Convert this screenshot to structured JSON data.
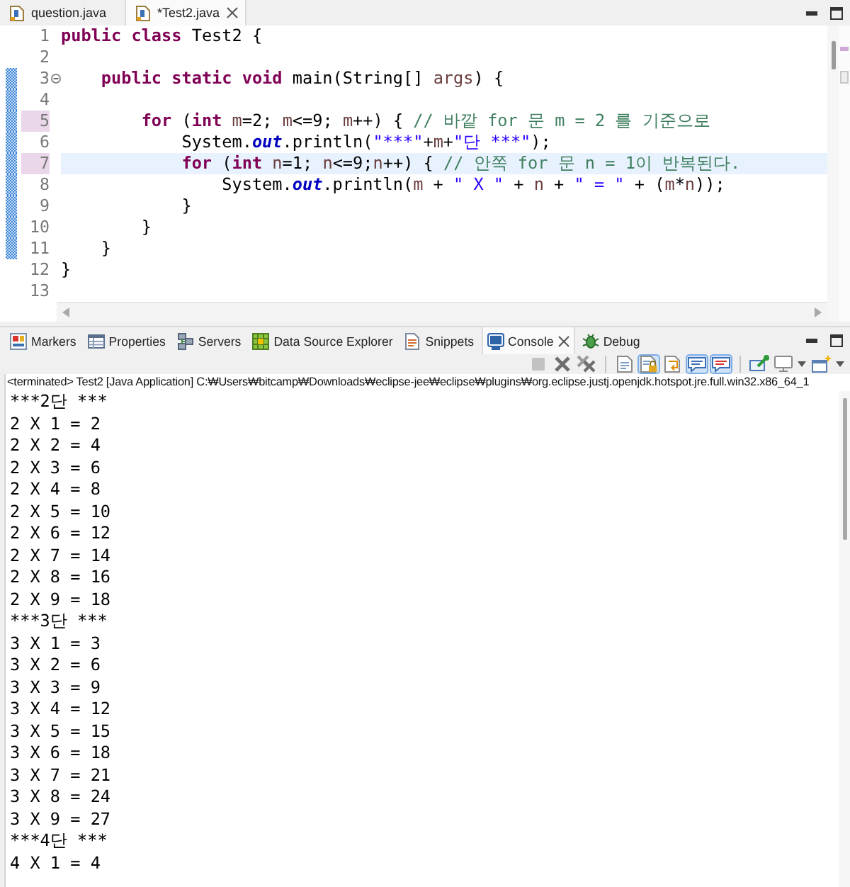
{
  "editor_tabs": [
    {
      "label": "question.java",
      "selected": false
    },
    {
      "label": "*Test2.java",
      "selected": true
    }
  ],
  "editor": {
    "lines": [
      {
        "number": "1",
        "changed": false,
        "marked": false,
        "current": false,
        "fold_marker": false,
        "tokens": [
          {
            "kind": "keyword",
            "text": "public"
          },
          {
            "kind": "keyword",
            "text": " class"
          },
          {
            "kind": "plain",
            "text": " Test2 {"
          }
        ]
      },
      {
        "number": "2",
        "changed": false,
        "marked": false,
        "current": false,
        "fold_marker": false
      },
      {
        "number": "3",
        "changed": true,
        "marked": false,
        "current": false,
        "fold_marker": true,
        "tokens": [
          {
            "kind": "keyword",
            "text": "    public"
          },
          {
            "kind": "keyword",
            "text": " static"
          },
          {
            "kind": "keyword",
            "text": " void"
          },
          {
            "kind": "plain",
            "text": " main(String[] "
          },
          {
            "kind": "variable",
            "text": "args"
          },
          {
            "kind": "plain",
            "text": ") {"
          }
        ]
      },
      {
        "number": "4",
        "changed": true,
        "marked": false,
        "current": false,
        "fold_marker": false
      },
      {
        "number": "5",
        "changed": true,
        "marked": true,
        "current": false,
        "fold_marker": false,
        "tokens": [
          {
            "kind": "keyword",
            "text": "        for"
          },
          {
            "kind": "plain",
            "text": " ("
          },
          {
            "kind": "keyword",
            "text": "int"
          },
          {
            "kind": "variable",
            "text": " m"
          },
          {
            "kind": "plain",
            "text": "=2; "
          },
          {
            "kind": "variable",
            "text": "m"
          },
          {
            "kind": "plain",
            "text": "<=9; "
          },
          {
            "kind": "variable",
            "text": "m"
          },
          {
            "kind": "plain",
            "text": "++) { "
          },
          {
            "kind": "comment",
            "text": "// 바깥 for 문 m = 2 를 기준으로"
          }
        ]
      },
      {
        "number": "6",
        "changed": true,
        "marked": false,
        "current": false,
        "fold_marker": false,
        "tokens": [
          {
            "kind": "plain",
            "text": "            System."
          },
          {
            "kind": "field",
            "text": "out"
          },
          {
            "kind": "plain",
            "text": ".println("
          },
          {
            "kind": "string",
            "text": "\"***\""
          },
          {
            "kind": "plain",
            "text": "+"
          },
          {
            "kind": "variable",
            "text": "m"
          },
          {
            "kind": "plain",
            "text": "+"
          },
          {
            "kind": "string",
            "text": "\"단 ***\""
          },
          {
            "kind": "plain",
            "text": ");"
          }
        ]
      },
      {
        "number": "7",
        "changed": true,
        "marked": true,
        "current": true,
        "fold_marker": false,
        "tokens": [
          {
            "kind": "keyword",
            "text": "            for"
          },
          {
            "kind": "plain",
            "text": " ("
          },
          {
            "kind": "keyword",
            "text": "int"
          },
          {
            "kind": "variable",
            "text": " n"
          },
          {
            "kind": "plain",
            "text": "=1; "
          },
          {
            "kind": "variable",
            "text": "n"
          },
          {
            "kind": "plain",
            "text": "<=9;"
          },
          {
            "kind": "variable",
            "text": "n"
          },
          {
            "kind": "plain",
            "text": "++) { "
          },
          {
            "kind": "comment",
            "text": "// 안쪽 for 문 n = 1이 반복된다."
          }
        ]
      },
      {
        "number": "8",
        "changed": true,
        "marked": false,
        "current": false,
        "fold_marker": false,
        "tokens": [
          {
            "kind": "plain",
            "text": "                System."
          },
          {
            "kind": "field",
            "text": "out"
          },
          {
            "kind": "plain",
            "text": ".println("
          },
          {
            "kind": "variable",
            "text": "m"
          },
          {
            "kind": "plain",
            "text": " + "
          },
          {
            "kind": "string",
            "text": "\" X \""
          },
          {
            "kind": "plain",
            "text": " + "
          },
          {
            "kind": "variable",
            "text": "n"
          },
          {
            "kind": "plain",
            "text": " + "
          },
          {
            "kind": "string",
            "text": "\" = \""
          },
          {
            "kind": "plain",
            "text": " + ("
          },
          {
            "kind": "variable",
            "text": "m"
          },
          {
            "kind": "plain",
            "text": "*"
          },
          {
            "kind": "variable",
            "text": "n"
          },
          {
            "kind": "plain",
            "text": "));"
          }
        ]
      },
      {
        "number": "9",
        "changed": true,
        "marked": false,
        "current": false,
        "fold_marker": false,
        "tokens": [
          {
            "kind": "plain",
            "text": "            }"
          }
        ]
      },
      {
        "number": "10",
        "changed": true,
        "marked": false,
        "current": false,
        "fold_marker": false,
        "tokens": [
          {
            "kind": "plain",
            "text": "        }"
          }
        ]
      },
      {
        "number": "11",
        "changed": true,
        "marked": false,
        "current": false,
        "fold_marker": false,
        "tokens": [
          {
            "kind": "plain",
            "text": "    }"
          }
        ]
      },
      {
        "number": "12",
        "changed": false,
        "marked": false,
        "current": false,
        "fold_marker": false,
        "tokens": [
          {
            "kind": "plain",
            "text": "}"
          }
        ]
      },
      {
        "number": "13",
        "changed": false,
        "marked": false,
        "current": false,
        "fold_marker": false
      }
    ]
  },
  "view_tabs": [
    {
      "label": "Markers",
      "kind": "markers",
      "selected": false
    },
    {
      "label": "Properties",
      "kind": "properties",
      "selected": false
    },
    {
      "label": "Servers",
      "kind": "servers",
      "selected": false
    },
    {
      "label": "Data Source Explorer",
      "kind": "data-source",
      "selected": false
    },
    {
      "label": "Snippets",
      "kind": "snippets",
      "selected": false
    },
    {
      "label": "Console",
      "kind": "console",
      "selected": true
    },
    {
      "label": "Debug",
      "kind": "debug",
      "selected": false
    }
  ],
  "console_toolbar": [
    [
      {
        "kind": "stop",
        "on": false,
        "disabled": true,
        "menu": false
      },
      {
        "kind": "remove",
        "on": false,
        "disabled": false,
        "menu": false
      },
      {
        "kind": "remove-all",
        "on": false,
        "disabled": false,
        "menu": false
      }
    ],
    [
      {
        "kind": "clear",
        "on": false,
        "disabled": false,
        "menu": false
      },
      {
        "kind": "scroll-lock",
        "on": true,
        "disabled": false,
        "menu": false
      },
      {
        "kind": "word-wrap",
        "on": false,
        "disabled": false,
        "menu": false
      },
      {
        "kind": "stdout",
        "on": true,
        "disabled": false,
        "menu": false
      },
      {
        "kind": "stderr",
        "on": true,
        "disabled": false,
        "menu": false
      }
    ],
    [
      {
        "kind": "pin",
        "on": false,
        "disabled": false,
        "menu": false
      },
      {
        "kind": "display",
        "on": false,
        "disabled": false,
        "menu": true
      },
      {
        "kind": "open",
        "on": false,
        "disabled": false,
        "menu": true
      }
    ]
  ],
  "console": {
    "header": "<terminated> Test2 [Java Application] C:₩Users₩bitcamp₩Downloads₩eclipse-jee₩eclipse₩plugins₩org.eclipse.justj.openjdk.hotspot.jre.full.win32.x86_64_1",
    "lines": [
      "***2단 ***",
      "2 X 1 = 2",
      "2 X 2 = 4",
      "2 X 3 = 6",
      "2 X 4 = 8",
      "2 X 5 = 10",
      "2 X 6 = 12",
      "2 X 7 = 14",
      "2 X 8 = 16",
      "2 X 9 = 18",
      "***3단 ***",
      "3 X 1 = 3",
      "3 X 2 = 6",
      "3 X 3 = 9",
      "3 X 4 = 12",
      "3 X 5 = 15",
      "3 X 6 = 18",
      "3 X 7 = 21",
      "3 X 8 = 24",
      "3 X 9 = 27",
      "***4단 ***",
      "4 X 1 = 4"
    ]
  }
}
